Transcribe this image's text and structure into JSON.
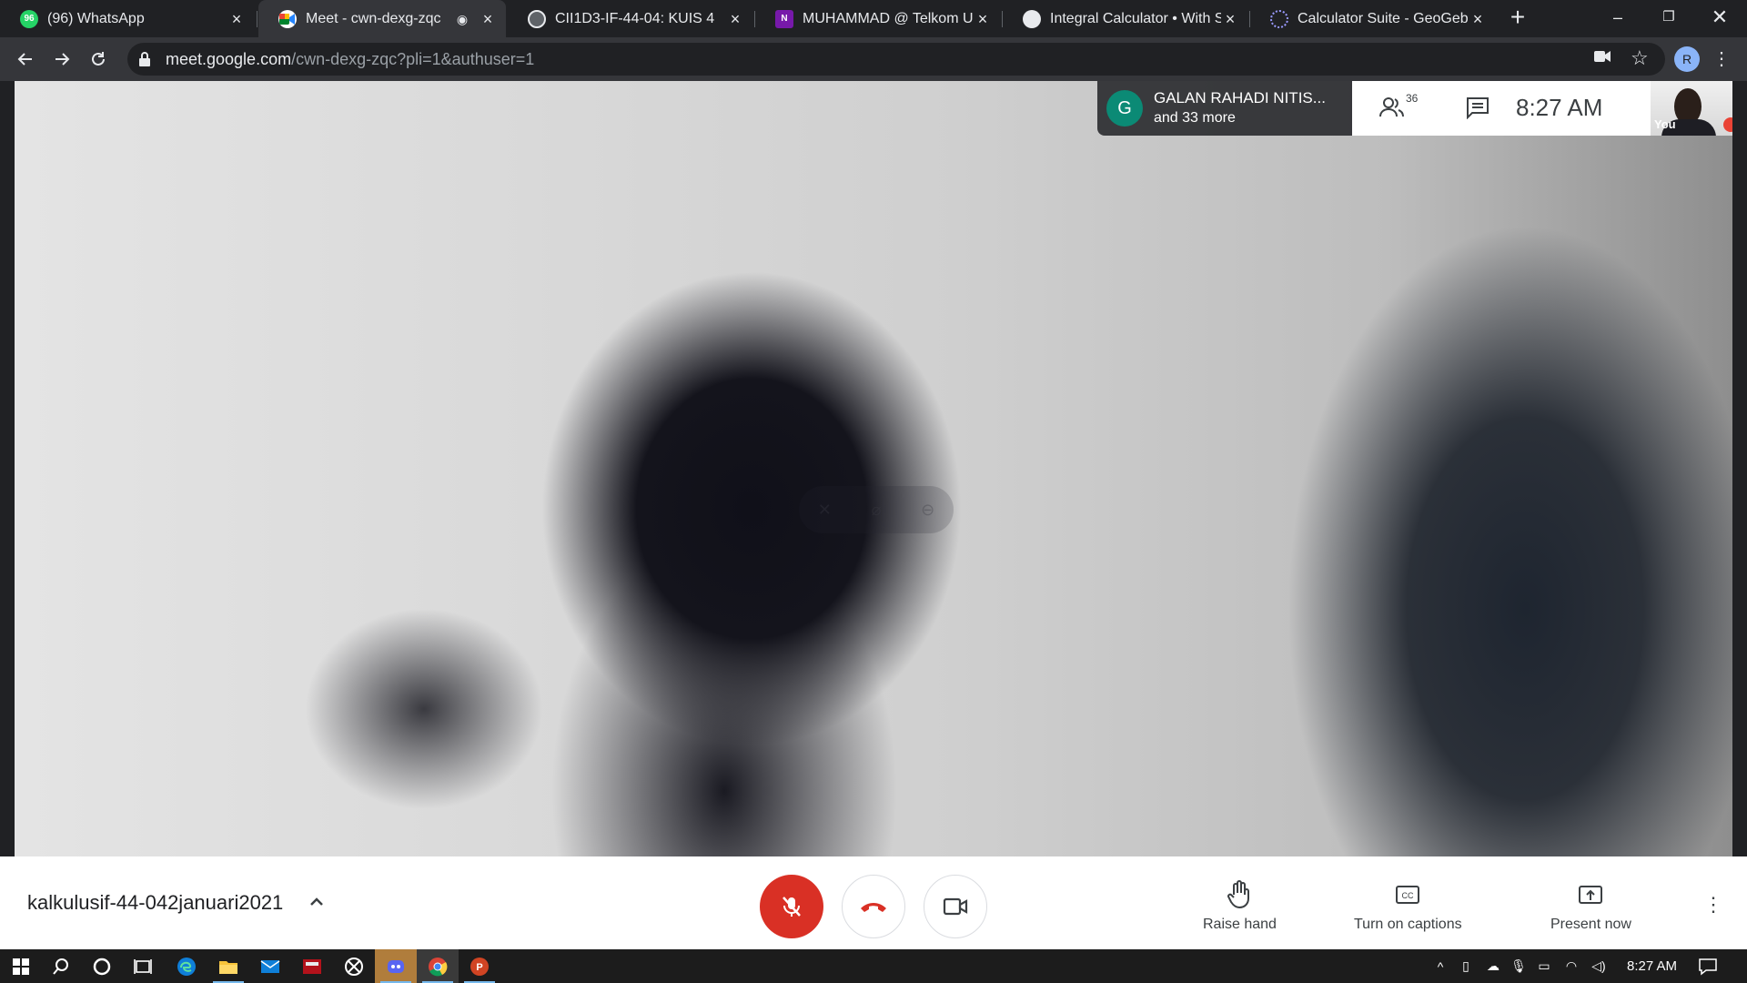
{
  "browser": {
    "tabs": [
      {
        "title": "(96) WhatsApp",
        "favicon": "whatsapp-icon",
        "favicon_color": "#25d366",
        "favicon_text": "96",
        "active": false
      },
      {
        "title": "Meet - cwn-dexg-zqc",
        "favicon": "google-meet-icon",
        "favicon_color": "#00897b",
        "favicon_text": "",
        "active": true,
        "recording": true
      },
      {
        "title": "CII1D3-IF-44-04: KUIS 4",
        "favicon": "moodle-icon",
        "favicon_color": "#9aa0a6",
        "favicon_text": "",
        "active": false
      },
      {
        "title": "MUHAMMAD @ Telkom Uni",
        "favicon": "onenote-icon",
        "favicon_color": "#7719aa",
        "favicon_text": "N",
        "active": false
      },
      {
        "title": "Integral Calculator • With Ste",
        "favicon": "calculator-site-icon",
        "favicon_color": "#e8eaed",
        "favicon_text": "",
        "active": false
      },
      {
        "title": "Calculator Suite - GeoGebra",
        "favicon": "geogebra-icon",
        "favicon_color": "#99f",
        "favicon_text": "",
        "active": false
      }
    ],
    "address": {
      "host": "meet.google.com",
      "path": "/cwn-dexg-zqc?pli=1&authuser=1"
    },
    "profile_initial": "R"
  },
  "meet": {
    "participants_chip": {
      "avatar_letter": "G",
      "avatar_color": "#0b8a75",
      "name": "GALAN RAHADI NITIS...",
      "more": "and 33 more"
    },
    "people_count": "36",
    "time": "8:27  AM",
    "self_label": "You",
    "meeting_code": "kalkulusif-44-042januari2021",
    "actions": {
      "raise_hand": "Raise hand",
      "captions": "Turn on captions",
      "present": "Present now"
    },
    "colors": {
      "mic_off": "#d93025",
      "hangup": "#d93025"
    }
  },
  "taskbar": {
    "clock": "8:27 AM"
  }
}
